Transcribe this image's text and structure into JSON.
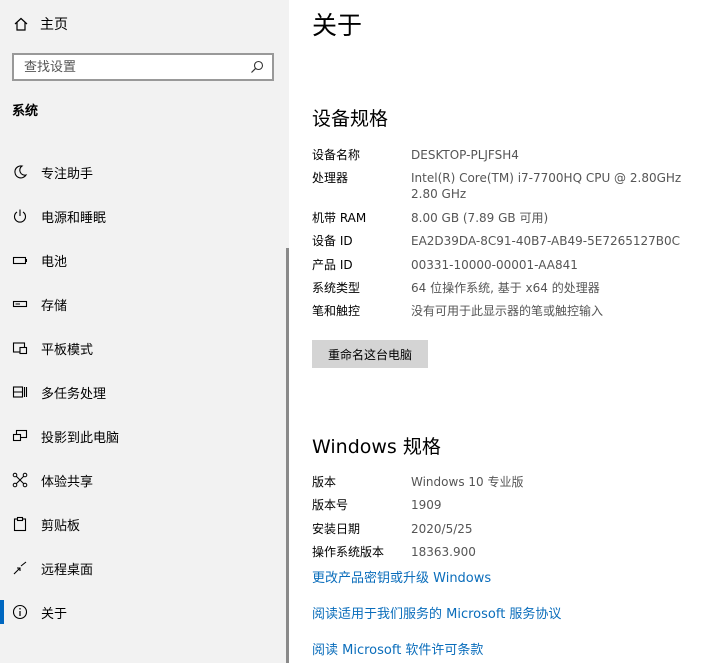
{
  "sidebar": {
    "home_label": "主页",
    "search_placeholder": "查找设置",
    "section_label": "系统",
    "items": [
      {
        "label": "专注助手",
        "icon": "moon-icon"
      },
      {
        "label": "电源和睡眠",
        "icon": "power-icon"
      },
      {
        "label": "电池",
        "icon": "battery-icon"
      },
      {
        "label": "存储",
        "icon": "storage-icon"
      },
      {
        "label": "平板模式",
        "icon": "tablet-mode-icon"
      },
      {
        "label": "多任务处理",
        "icon": "multitasking-icon"
      },
      {
        "label": "投影到此电脑",
        "icon": "project-icon"
      },
      {
        "label": "体验共享",
        "icon": "shared-experiences-icon"
      },
      {
        "label": "剪贴板",
        "icon": "clipboard-icon"
      },
      {
        "label": "远程桌面",
        "icon": "remote-desktop-icon"
      },
      {
        "label": "关于",
        "icon": "info-icon",
        "selected": true
      }
    ]
  },
  "main": {
    "title": "关于",
    "device_specs": {
      "heading": "设备规格",
      "rows": [
        {
          "key": "设备名称",
          "value": "DESKTOP-PLJFSH4"
        },
        {
          "key": "处理器",
          "value": "Intel(R) Core(TM) i7-7700HQ CPU @ 2.80GHz   2.80 GHz"
        },
        {
          "key": "机带 RAM",
          "value": "8.00 GB (7.89 GB 可用)"
        },
        {
          "key": "设备 ID",
          "value": "EA2D39DA-8C91-40B7-AB49-5E7265127B0C"
        },
        {
          "key": "产品 ID",
          "value": "00331-10000-00001-AA841"
        },
        {
          "key": "系统类型",
          "value": "64 位操作系统, 基于 x64 的处理器"
        },
        {
          "key": "笔和触控",
          "value": "没有可用于此显示器的笔或触控输入"
        }
      ],
      "rename_button": "重命名这台电脑"
    },
    "windows_specs": {
      "heading": "Windows 规格",
      "rows": [
        {
          "key": "版本",
          "value": "Windows 10 专业版"
        },
        {
          "key": "版本号",
          "value": "1909"
        },
        {
          "key": "安装日期",
          "value": "2020/5/25"
        },
        {
          "key": "操作系统版本",
          "value": "18363.900"
        }
      ],
      "links": [
        "更改产品密钥或升级 Windows",
        "阅读适用于我们服务的 Microsoft 服务协议",
        "阅读 Microsoft 软件许可条款"
      ]
    }
  },
  "colors": {
    "sidebar_bg": "#f2f2f2",
    "accent": "#0067c0",
    "link": "#0a6dbb",
    "button_bg": "#d4d4d4"
  }
}
